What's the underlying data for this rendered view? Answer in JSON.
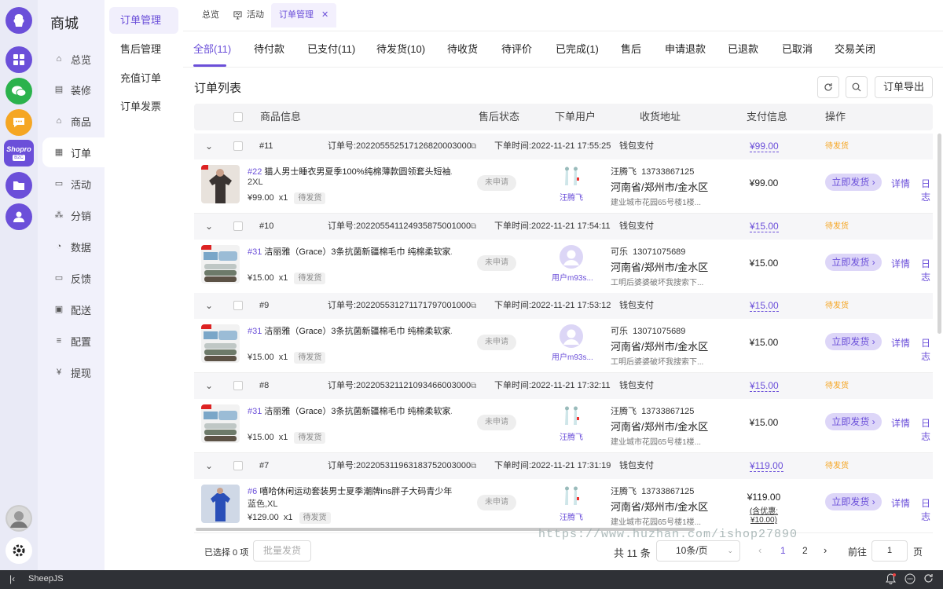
{
  "app": {
    "brand": "商城",
    "footer_name": "SheepJS"
  },
  "rail": [
    {
      "icon": "shop-logo-icon"
    },
    {
      "icon": "apps-icon"
    },
    {
      "icon": "wechat-icon"
    },
    {
      "icon": "chat-icon"
    },
    {
      "icon": "shopro-logo",
      "label": "Shopro",
      "sublabel": "B2C"
    },
    {
      "icon": "folder-icon"
    },
    {
      "icon": "user-icon"
    }
  ],
  "sidebar": [
    {
      "label": "总览",
      "icon": "home-icon"
    },
    {
      "label": "装修",
      "icon": "store-icon"
    },
    {
      "label": "商品",
      "icon": "bag-icon"
    },
    {
      "label": "订单",
      "icon": "order-icon",
      "active": true
    },
    {
      "label": "活动",
      "icon": "activity-icon"
    },
    {
      "label": "分销",
      "icon": "share-icon"
    },
    {
      "label": "数据",
      "icon": "chart-icon"
    },
    {
      "label": "反馈",
      "icon": "feedback-icon"
    },
    {
      "label": "配送",
      "icon": "delivery-icon"
    },
    {
      "label": "配置",
      "icon": "settings-icon"
    },
    {
      "label": "提现",
      "icon": "yuan-icon"
    }
  ],
  "submenu": [
    {
      "label": "订单管理",
      "active": true
    },
    {
      "label": "售后管理"
    },
    {
      "label": "充值订单"
    },
    {
      "label": "订单发票"
    }
  ],
  "top_tabs": {
    "t1": "总览",
    "t2": "活动",
    "t3": "订单管理"
  },
  "status_tabs": [
    "全部(11)",
    "待付款",
    "已支付(11)",
    "待发货(10)",
    "待收货",
    "待评价",
    "已完成(1)",
    "售后",
    "申请退款",
    "已退款",
    "已取消",
    "交易关闭"
  ],
  "list": {
    "title": "订单列表",
    "export": "订单导出"
  },
  "columns": {
    "product": "商品信息",
    "after": "售后状态",
    "user": "下单用户",
    "address": "收货地址",
    "pay": "支付信息",
    "ops": "操作"
  },
  "orders": [
    {
      "seq": "#11",
      "order_no_label": "订单号:2022055525171268200030​00",
      "time": "下单时间:2022-11-21 17:55:25",
      "pay_method": "钱包支付",
      "pay_total": "¥99.00",
      "status": "待发货",
      "pid": "#22",
      "pname": "猫人男士睡衣男夏季100%纯棉薄款圆领套头短袖...",
      "spec": "2XL",
      "price": "¥99.00",
      "qty": "x1",
      "tag": "待发货",
      "after": "未申请",
      "user": "汪腾飞",
      "rname": "汪腾飞",
      "phone": "13733867125",
      "region": "河南省/郑州市/金水区",
      "detail_addr": "建业城市花园65号楼1楼...",
      "amount": "¥99.00",
      "discount": "",
      "ship": "立即发货",
      "detail": "详情",
      "log": "日志"
    },
    {
      "seq": "#10",
      "order_no_label": "订单号:2022055411249358750010​00",
      "time": "下单时间:2022-11-21 17:54:11",
      "pay_method": "钱包支付",
      "pay_total": "¥15.00",
      "status": "待发货",
      "pid": "#31",
      "pname": "洁丽雅（Grace）3条抗菌新疆棉毛巾 纯棉柔软家...",
      "spec": "",
      "price": "¥15.00",
      "qty": "x1",
      "tag": "待发货",
      "after": "未申请",
      "user": "用户m93s...",
      "rname": "可乐",
      "phone": "13071075689",
      "region": "河南省/郑州市/金水区",
      "detail_addr": "工明后婆婆破坏我搜索下...",
      "amount": "¥15.00",
      "discount": "",
      "ship": "立即发货",
      "detail": "详情",
      "log": "日志"
    },
    {
      "seq": "#9",
      "order_no_label": "订单号:2022055312711717970010​00",
      "time": "下单时间:2022-11-21 17:53:12",
      "pay_method": "钱包支付",
      "pay_total": "¥15.00",
      "status": "待发货",
      "pid": "#31",
      "pname": "洁丽雅（Grace）3条抗菌新疆棉毛巾 纯棉柔软家...",
      "spec": "",
      "price": "¥15.00",
      "qty": "x1",
      "tag": "待发货",
      "after": "未申请",
      "user": "用户m93s...",
      "rname": "可乐",
      "phone": "13071075689",
      "region": "河南省/郑州市/金水区",
      "detail_addr": "工明后婆婆破坏我搜索下...",
      "amount": "¥15.00",
      "discount": "",
      "ship": "立即发货",
      "detail": "详情",
      "log": "日志"
    },
    {
      "seq": "#8",
      "order_no_label": "订单号:2022053211210934660030​00",
      "time": "下单时间:2022-11-21 17:32:11",
      "pay_method": "钱包支付",
      "pay_total": "¥15.00",
      "status": "待发货",
      "pid": "#31",
      "pname": "洁丽雅（Grace）3条抗菌新疆棉毛巾 纯棉柔软家...",
      "spec": "",
      "price": "¥15.00",
      "qty": "x1",
      "tag": "待发货",
      "after": "未申请",
      "user": "汪腾飞",
      "rname": "汪腾飞",
      "phone": "13733867125",
      "region": "河南省/郑州市/金水区",
      "detail_addr": "建业城市花园65号楼1楼...",
      "amount": "¥15.00",
      "discount": "",
      "ship": "立即发货",
      "detail": "详情",
      "log": "日志"
    },
    {
      "seq": "#7",
      "order_no_label": "订单号:2022053119631837520030​00",
      "time": "下单时间:2022-11-21 17:31:19",
      "pay_method": "钱包支付",
      "pay_total": "¥119.00",
      "status": "待发货",
      "pid": "#6",
      "pname": "嘻哈休闲运动套装男士夏季潮牌ins胖子大码青少年...",
      "spec": "蓝色,XL",
      "price": "¥129.00",
      "qty": "x1",
      "tag": "待发货",
      "after": "未申请",
      "user": "汪腾飞",
      "rname": "汪腾飞",
      "phone": "13733867125",
      "region": "河南省/郑州市/金水区",
      "detail_addr": "建业城市花园65号楼1楼...",
      "amount": "¥119.00",
      "discount": "(含优惠: ¥10.00)",
      "ship": "立即发货",
      "detail": "详情",
      "log": "日志"
    }
  ],
  "footer": {
    "selected": "已选择 0 项",
    "batch": "批量发货",
    "total": "共 11 条",
    "page_size": "10条/页",
    "page1": "1",
    "page2": "2",
    "goto": "前往",
    "goto_val": "1",
    "page_unit": "页"
  },
  "watermark": "https://www.huzhan.com/ishop27890"
}
